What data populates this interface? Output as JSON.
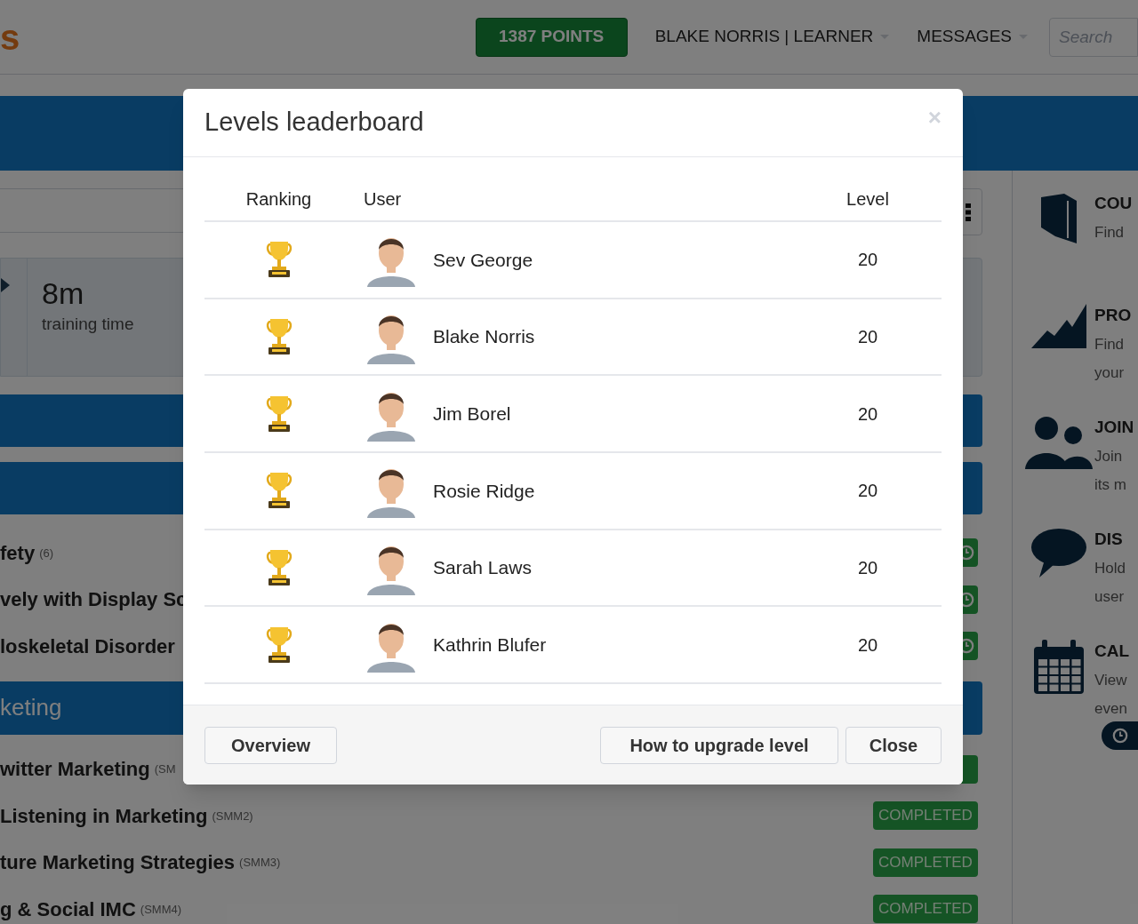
{
  "header": {
    "logo": "s",
    "points_button": "1387 POINTS",
    "user_menu": "BLAKE NORRIS | LEARNER",
    "messages_menu": "MESSAGES",
    "search": {
      "placeholder": "Search"
    }
  },
  "stats": {
    "value": "8m",
    "label": "training time"
  },
  "course_list": [
    {
      "kind": "bar"
    },
    {
      "kind": "bar"
    },
    {
      "kind": "course",
      "title": "fety",
      "code": "(6)",
      "badge": {
        "kind": "clock"
      }
    },
    {
      "kind": "course",
      "title": "vely with Display Sc",
      "badge": {
        "kind": "clock"
      }
    },
    {
      "kind": "course",
      "title": "loskeletal Disorder",
      "badge": {
        "kind": "clock"
      }
    },
    {
      "kind": "heading",
      "title": "keting"
    },
    {
      "kind": "course",
      "title": "witter Marketing",
      "code": "(SM",
      "badge": {
        "kind": "plain"
      }
    },
    {
      "kind": "course",
      "title": "Listening in Marketing",
      "code": "(SMM2)",
      "badge": {
        "kind": "label",
        "status": "COMPLETED"
      }
    },
    {
      "kind": "course",
      "title": "ture Marketing Strategies",
      "code": "(SMM3)",
      "badge": {
        "kind": "label",
        "status": "COMPLETED"
      }
    },
    {
      "kind": "course",
      "title": "g & Social IMC",
      "code": "(SMM4)",
      "badge": {
        "kind": "label",
        "status": "COMPLETED"
      }
    }
  ],
  "sidebar": [
    {
      "kind": "book",
      "title": "COU",
      "lines": [
        "Find"
      ]
    },
    {
      "kind": "chart",
      "title": "PRO",
      "lines": [
        "Find",
        "your"
      ]
    },
    {
      "kind": "people",
      "title": "JOIN",
      "lines": [
        "Join",
        "its m"
      ]
    },
    {
      "kind": "chat",
      "title": "DIS",
      "lines": [
        "Hold",
        "user"
      ]
    },
    {
      "kind": "calendar",
      "title": "CAL",
      "lines": [
        "View",
        "even"
      ]
    }
  ],
  "modal": {
    "title": "Levels leaderboard",
    "close": "×",
    "columns": [
      "Ranking",
      "User",
      "Level"
    ],
    "rows": [
      {
        "user": "Sev George",
        "level_label": "20"
      },
      {
        "user": "Blake Norris",
        "level_label": "20"
      },
      {
        "user": "Jim Borel",
        "level_label": "20"
      },
      {
        "user": "Rosie Ridge",
        "level_label": "20"
      },
      {
        "user": "Sarah Laws",
        "level_label": "20"
      },
      {
        "user": "Kathrin Blufer",
        "level_label": "20"
      }
    ],
    "buttons": {
      "overview": "Overview",
      "upgrade": "How to upgrade level",
      "close": "Close"
    }
  }
}
